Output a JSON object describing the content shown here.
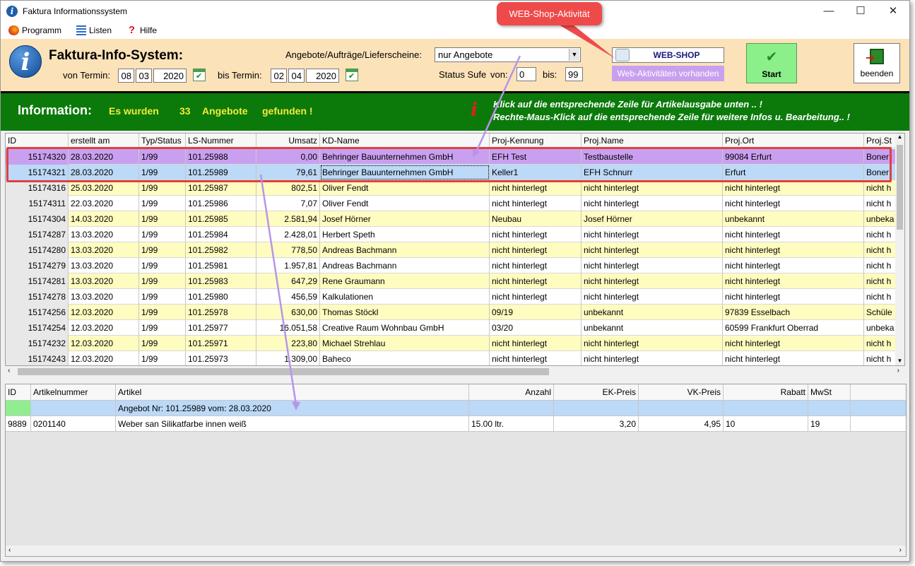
{
  "window": {
    "title": "Faktura Informationssystem",
    "minimize": "—",
    "maximize": "☐",
    "close": "✕"
  },
  "menu": [
    {
      "label": "Programm",
      "icon": "firefox-icon"
    },
    {
      "label": "Listen",
      "icon": "list-icon"
    },
    {
      "label": "Hilfe",
      "icon": "help-icon"
    }
  ],
  "header": {
    "app_title": "Faktura-Info-System:",
    "von_label": "von Termin:",
    "von": {
      "day": "08",
      "month": "03",
      "year": "2020"
    },
    "bis_label": "bis Termin:",
    "bis": {
      "day": "02",
      "month": "04",
      "year": "2020"
    },
    "doc_label": "Angebote/Aufträge/Lieferscheine:",
    "doc_value": "nur Angebote",
    "status_label": "Status Sufe",
    "status_von_label": "von:",
    "status_von": "0",
    "status_bis_label": "bis:",
    "status_bis": "99",
    "webshop_label": "WEB-SHOP",
    "webakt_label": "Web-Aktivitäten vorhanden",
    "start_label": "Start",
    "end_label": "beenden"
  },
  "callout": "WEB-Shop-Aktivität",
  "info": {
    "label": "Information:",
    "msg_prefix": "Es wurden",
    "count": "33",
    "msg_type": "Angebote",
    "msg_suffix": "gefunden !",
    "hint1": "Klick auf die entsprechende Zeile für Artikelausgabe unten .. !",
    "hint2": "Rechte-Maus-Klick auf die entsprechende Zeile für weitere Infos u. Bearbeitung.. !"
  },
  "grid": {
    "columns": [
      "ID",
      "erstellt am",
      "Typ/Status",
      "LS-Nummer",
      "Umsatz",
      "KD-Name",
      "Proj-Kennung",
      "Proj.Name",
      "Proj.Ort",
      "Proj.St"
    ],
    "rows": [
      {
        "id": "15174320",
        "date": "28.03.2020",
        "typ": "1/99",
        "ls": "101.25988",
        "umsatz": "0,00",
        "kd": "Behringer Bauunternehmen GmbH",
        "kenn": "EFH Test",
        "pname": "Testbaustelle",
        "ort": "99084 Erfurt",
        "st": "Boner"
      },
      {
        "id": "15174321",
        "date": "28.03.2020",
        "typ": "1/99",
        "ls": "101.25989",
        "umsatz": "79,61",
        "kd": "Behringer Bauunternehmen GmbH",
        "kenn": "Keller1",
        "pname": "EFH Schnurr",
        "ort": "Erfurt",
        "st": "Boner"
      },
      {
        "id": "15174316",
        "date": "25.03.2020",
        "typ": "1/99",
        "ls": "101.25987",
        "umsatz": "802,51",
        "kd": "Oliver Fendt",
        "kenn": "nicht hinterlegt",
        "pname": "nicht hinterlegt",
        "ort": "nicht hinterlegt",
        "st": "nicht h"
      },
      {
        "id": "15174311",
        "date": "22.03.2020",
        "typ": "1/99",
        "ls": "101.25986",
        "umsatz": "7,07",
        "kd": "Oliver Fendt",
        "kenn": "nicht hinterlegt",
        "pname": "nicht hinterlegt",
        "ort": "nicht hinterlegt",
        "st": "nicht h"
      },
      {
        "id": "15174304",
        "date": "14.03.2020",
        "typ": "1/99",
        "ls": "101.25985",
        "umsatz": "2.581,94",
        "kd": "Josef Hörner",
        "kenn": "Neubau",
        "pname": "Josef Hörner",
        "ort": "unbekannt",
        "st": "unbeka"
      },
      {
        "id": "15174287",
        "date": "13.03.2020",
        "typ": "1/99",
        "ls": "101.25984",
        "umsatz": "2.428,01",
        "kd": "Herbert Speth",
        "kenn": "nicht hinterlegt",
        "pname": "nicht hinterlegt",
        "ort": "nicht hinterlegt",
        "st": "nicht h"
      },
      {
        "id": "15174280",
        "date": "13.03.2020",
        "typ": "1/99",
        "ls": "101.25982",
        "umsatz": "778,50",
        "kd": "Andreas Bachmann",
        "kenn": "nicht hinterlegt",
        "pname": "nicht hinterlegt",
        "ort": "nicht hinterlegt",
        "st": "nicht h"
      },
      {
        "id": "15174279",
        "date": "13.03.2020",
        "typ": "1/99",
        "ls": "101.25981",
        "umsatz": "1.957,81",
        "kd": "Andreas Bachmann",
        "kenn": "nicht hinterlegt",
        "pname": "nicht hinterlegt",
        "ort": "nicht hinterlegt",
        "st": "nicht h"
      },
      {
        "id": "15174281",
        "date": "13.03.2020",
        "typ": "1/99",
        "ls": "101.25983",
        "umsatz": "647,29",
        "kd": "Rene Graumann",
        "kenn": "nicht hinterlegt",
        "pname": "nicht hinterlegt",
        "ort": "nicht hinterlegt",
        "st": "nicht h"
      },
      {
        "id": "15174278",
        "date": "13.03.2020",
        "typ": "1/99",
        "ls": "101.25980",
        "umsatz": "456,59",
        "kd": "Kalkulationen",
        "kenn": "nicht hinterlegt",
        "pname": "nicht hinterlegt",
        "ort": "nicht hinterlegt",
        "st": "nicht h"
      },
      {
        "id": "15174256",
        "date": "12.03.2020",
        "typ": "1/99",
        "ls": "101.25978",
        "umsatz": "630,00",
        "kd": "Thomas Stöckl",
        "kenn": "09/19",
        "pname": "unbekannt",
        "ort": "97839 Esselbach",
        "st": "Schüle"
      },
      {
        "id": "15174254",
        "date": "12.03.2020",
        "typ": "1/99",
        "ls": "101.25977",
        "umsatz": "16.051,58",
        "kd": "Creative Raum Wohnbau GmbH",
        "kenn": "03/20",
        "pname": "unbekannt",
        "ort": "60599 Frankfurt Oberrad",
        "st": "unbeka"
      },
      {
        "id": "15174232",
        "date": "12.03.2020",
        "typ": "1/99",
        "ls": "101.25971",
        "umsatz": "223,80",
        "kd": "Michael Strehlau",
        "kenn": "nicht hinterlegt",
        "pname": "nicht hinterlegt",
        "ort": "nicht hinterlegt",
        "st": "nicht h"
      },
      {
        "id": "15174243",
        "date": "12.03.2020",
        "typ": "1/99",
        "ls": "101.25973",
        "umsatz": "1.309,00",
        "kd": "Baheco",
        "kenn": "nicht hinterlegt",
        "pname": "nicht hinterlegt",
        "ort": "nicht hinterlegt",
        "st": "nicht h"
      }
    ]
  },
  "articles": {
    "columns": [
      "ID",
      "Artikelnummer",
      "Artikel",
      "Anzahl",
      "EK-Preis",
      "VK-Preis",
      "Rabatt",
      "MwSt"
    ],
    "group_label": "Angebot Nr: 101.25989 vom: 28.03.2020",
    "rows": [
      {
        "id": "9889",
        "nr": "0201140",
        "name": "Weber san Silikatfarbe innen weiß",
        "anzahl": "15.00 ltr.",
        "ek": "3,20",
        "vk": "4,95",
        "rabatt": "10",
        "mwst": "19"
      }
    ]
  },
  "colors": {
    "header_bg": "#fbe2b9",
    "info_bg": "#0b7a0b",
    "row_yellow": "#fffcc0",
    "row_white": "#ffffff",
    "row_purple": "#c9a0f0",
    "row_blue": "#bcd9f7",
    "highlight_red": "#e04040"
  }
}
